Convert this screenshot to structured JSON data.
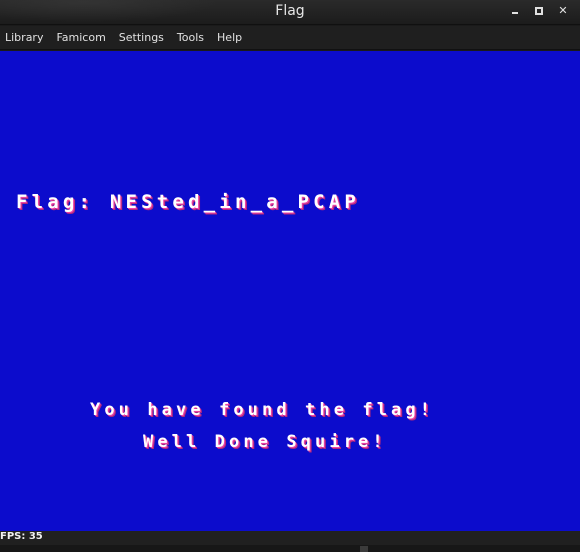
{
  "window": {
    "title": "Flag"
  },
  "menu": [
    "Library",
    "Famicom",
    "Settings",
    "Tools",
    "Help"
  ],
  "screen": {
    "flag_line": "Flag: NESted_in_a_PCAP",
    "message_line1": "You have found the flag!",
    "message_line2": "Well Done Squire!",
    "background_color": "#0c0ccc"
  },
  "status": {
    "fps": "FPS: 35"
  },
  "icons": [
    "minimize-icon",
    "maximize-icon",
    "close-icon"
  ]
}
